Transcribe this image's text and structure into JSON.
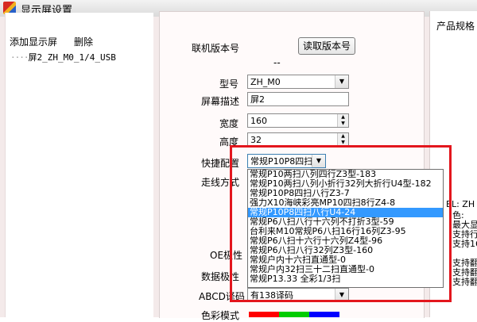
{
  "window": {
    "title": "显示屏设置"
  },
  "left_panel": {
    "add_label": "添加显示屏",
    "delete_label": "删除",
    "tree_item": "屏2_ZH_M0_1/4_USB"
  },
  "form": {
    "version_label": "联机版本号",
    "read_version_button": "读取版本号",
    "version_value": "--",
    "model_label": "型号",
    "model_value": "ZH_M0",
    "desc_label": "屏幕描述",
    "desc_value": "屏2",
    "width_label": "宽度",
    "width_value": "160",
    "height_label": "高度",
    "height_value": "32",
    "quick_label": "快捷配置",
    "quick_value": "常规P10P8四扫八行\\",
    "wiring_label": "走线方式",
    "oe_label": "OE极性",
    "data_label": "数据极性",
    "abcd_label": "ABCD译码",
    "abcd_value": "有138译码",
    "color_label": "色彩模式"
  },
  "dropdown": {
    "items": [
      "常规P10两扫八列四行Z3型-183",
      "常规P10两扫八列小折行32列大折行U4型-182",
      "常规P10P8四扫八行Z3-7",
      "强力X10海峡彩亮MP10四扫8行Z4-8",
      "常规P10P8四扫八行U4-24",
      "常规P6八扫八行十六列不打折3型-59",
      "台利来M10常规P6八扫16行16列Z3-95",
      "常规P6八扫十六行十六列Z4型-96",
      "常规P6八扫八行32列Z3型-160",
      "常规户内十六扫直通型-0",
      "常规户内32扫三十二扫直通型-0",
      "常规P13.33 全彩1/3扫"
    ],
    "selected_index": 4
  },
  "right_panel": {
    "title": "产品规格",
    "lines": [
      "EL: ZH",
      "色:",
      "最大显示",
      "支持行",
      "支持16",
      "支持翻",
      "支持翻",
      "支持翻"
    ]
  },
  "colors": {
    "highlight": "#e3161d",
    "selection": "#3399ff",
    "color_bar": [
      "#ff0000",
      "#00cc00",
      "#0000ff"
    ]
  }
}
